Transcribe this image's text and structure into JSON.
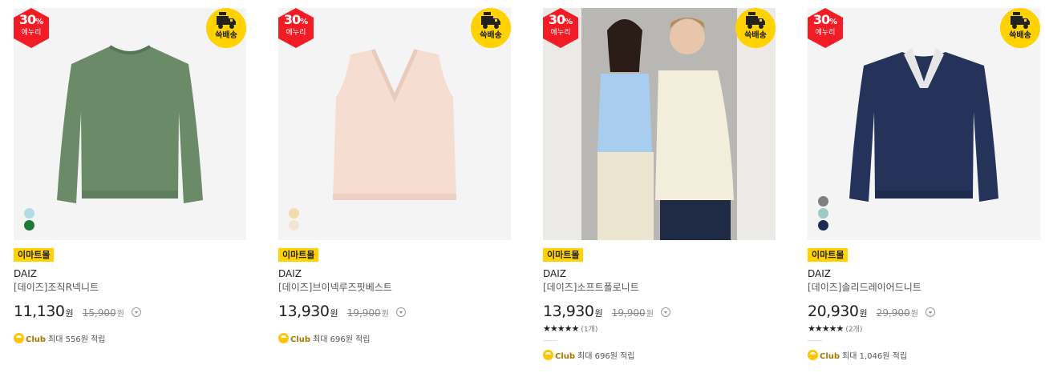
{
  "products": [
    {
      "sale": {
        "pct": "30",
        "unit": "%",
        "label": "에누리"
      },
      "shipping_label": "쓱배송",
      "mall_tag": "이마트몰",
      "brand": "DAIZ",
      "name": "[데이즈]조직R넥니트",
      "price": "11,130",
      "price_unit": "원",
      "original_price": "15,900",
      "original_unit": "원",
      "rating": null,
      "club": {
        "label": "Club",
        "text": "최대 556원 적립"
      },
      "swatches": [
        "#b4dbe3",
        "#1f7a3a"
      ],
      "garment": {
        "kind": "sweater",
        "color": "#6a8a68"
      }
    },
    {
      "sale": {
        "pct": "30",
        "unit": "%",
        "label": "에누리"
      },
      "shipping_label": "쓱배송",
      "mall_tag": "이마트몰",
      "brand": "DAIZ",
      "name": "[데이즈]브이넥루즈핏베스트",
      "price": "13,930",
      "price_unit": "원",
      "original_price": "19,900",
      "original_unit": "원",
      "rating": null,
      "club": {
        "label": "Club",
        "text": "최대 696원 적립"
      },
      "swatches": [
        "#f1dcae",
        "#f6e4d2"
      ],
      "garment": {
        "kind": "vest",
        "color": "#f5ddd1"
      }
    },
    {
      "sale": {
        "pct": "30",
        "unit": "%",
        "label": "에누리"
      },
      "shipping_label": "쓱배송",
      "mall_tag": "이마트몰",
      "brand": "DAIZ",
      "name": "[데이즈]소프트폴로니트",
      "price": "13,930",
      "price_unit": "원",
      "original_price": "19,900",
      "original_unit": "원",
      "rating": {
        "stars": "★★★★★",
        "count": "(1개)"
      },
      "club": {
        "label": "Club",
        "text": "최대 696원 적립"
      },
      "swatches": [],
      "garment": {
        "kind": "models",
        "color": "#f2eedb"
      }
    },
    {
      "sale": {
        "pct": "30",
        "unit": "%",
        "label": "에누리"
      },
      "shipping_label": "쓱배송",
      "mall_tag": "이마트몰",
      "brand": "DAIZ",
      "name": "[데이즈]솔리드레이어드니트",
      "price": "20,930",
      "price_unit": "원",
      "original_price": "29,900",
      "original_unit": "원",
      "rating": {
        "stars": "★★★★★",
        "count": "(2개)"
      },
      "club": {
        "label": "Club",
        "text": "최대 1,046원 적립"
      },
      "swatches": [
        "#7f7f7f",
        "#9fc9c4",
        "#1e2c55"
      ],
      "garment": {
        "kind": "layered",
        "color": "#25335a"
      }
    }
  ]
}
